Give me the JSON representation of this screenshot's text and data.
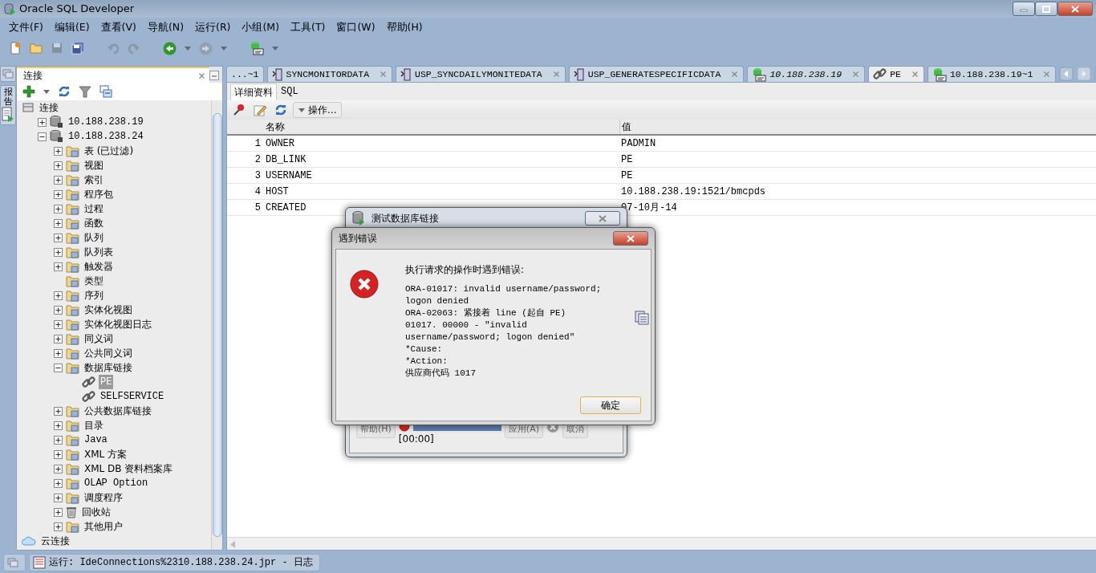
{
  "window": {
    "title": "Oracle SQL Developer"
  },
  "menu": [
    "文件(F)",
    "编辑(E)",
    "查看(V)",
    "导航(N)",
    "运行(R)",
    "小组(M)",
    "工具(T)",
    "窗口(W)",
    "帮助(H)"
  ],
  "toolbar": [
    {
      "kind": "new",
      "disabled": false
    },
    {
      "kind": "open",
      "disabled": false
    },
    {
      "kind": "save",
      "disabled": true
    },
    {
      "kind": "saveall",
      "disabled": false
    },
    {
      "kind": "undo",
      "disabled": true
    },
    {
      "kind": "redo",
      "disabled": true
    },
    {
      "kind": "back",
      "disabled": false
    },
    {
      "kind": "forward",
      "disabled": true
    },
    {
      "kind": "sql",
      "disabled": false
    }
  ],
  "side_tab": {
    "label": "报告"
  },
  "connections_panel": {
    "title": "连接",
    "tree": [
      {
        "label": "连接",
        "kind": "root",
        "selected": false,
        "children": [
          {
            "label": "10.188.238.19",
            "kind": "db",
            "expanded": false,
            "selected": false
          },
          {
            "label": "10.188.238.24",
            "kind": "db",
            "expanded": true,
            "selected": false,
            "children": [
              {
                "label": "表 (已过滤)",
                "kind": "folder",
                "expanded": false,
                "selected": false
              },
              {
                "label": "视图",
                "kind": "folder",
                "expanded": false,
                "selected": false
              },
              {
                "label": "索引",
                "kind": "folder",
                "expanded": false,
                "selected": false
              },
              {
                "label": "程序包",
                "kind": "folder",
                "expanded": false,
                "selected": false
              },
              {
                "label": "过程",
                "kind": "folder",
                "expanded": false,
                "selected": false
              },
              {
                "label": "函数",
                "kind": "folder",
                "expanded": false,
                "selected": false
              },
              {
                "label": "队列",
                "kind": "folder",
                "expanded": false,
                "selected": false
              },
              {
                "label": "队列表",
                "kind": "folder",
                "expanded": false,
                "selected": false
              },
              {
                "label": "触发器",
                "kind": "folder",
                "expanded": false,
                "selected": false
              },
              {
                "label": "类型",
                "kind": "folder",
                "selected": false
              },
              {
                "label": "序列",
                "kind": "folder",
                "expanded": false,
                "selected": false
              },
              {
                "label": "实体化视图",
                "kind": "folder",
                "expanded": false,
                "selected": false
              },
              {
                "label": "实体化视图日志",
                "kind": "folder",
                "expanded": false,
                "selected": false
              },
              {
                "label": "同义词",
                "kind": "folder",
                "expanded": false,
                "selected": false
              },
              {
                "label": "公共同义词",
                "kind": "folder",
                "expanded": false,
                "selected": false
              },
              {
                "label": "数据库链接",
                "kind": "folder",
                "expanded": true,
                "selected": false,
                "children": [
                  {
                    "label": "PE",
                    "kind": "link",
                    "selected": true
                  },
                  {
                    "label": "SELFSERVICE",
                    "kind": "link",
                    "selected": false
                  }
                ]
              },
              {
                "label": "公共数据库链接",
                "kind": "folder",
                "expanded": false,
                "selected": false
              },
              {
                "label": "目录",
                "kind": "folder",
                "expanded": false,
                "selected": false
              },
              {
                "label": "Java",
                "kind": "folder",
                "expanded": false,
                "selected": false
              },
              {
                "label": "XML 方案",
                "kind": "folder",
                "expanded": false,
                "selected": false
              },
              {
                "label": "XML DB 资料档案库",
                "kind": "folder",
                "expanded": false,
                "selected": false
              },
              {
                "label": "OLAP Option",
                "kind": "folder",
                "expanded": false,
                "selected": false
              },
              {
                "label": "调度程序",
                "kind": "folder",
                "expanded": false,
                "selected": false
              },
              {
                "label": "回收站",
                "kind": "trash",
                "expanded": false,
                "selected": false
              },
              {
                "label": "其他用户",
                "kind": "folder",
                "expanded": false,
                "selected": false
              }
            ]
          }
        ]
      },
      {
        "label": "云连接",
        "kind": "cloud",
        "selected": false
      }
    ]
  },
  "editor": {
    "tabs": [
      {
        "label": "...~1",
        "kind": "none",
        "selected": false,
        "italic": false,
        "closable": false
      },
      {
        "label": "SYNCMONITORDATA",
        "kind": "procedure",
        "selected": false,
        "italic": false,
        "closable": true
      },
      {
        "label": "USP_SYNCDAILYMONITEDATA",
        "kind": "procedure",
        "selected": false,
        "italic": false,
        "closable": true
      },
      {
        "label": "USP_GENERATESPECIFICDATA",
        "kind": "procedure",
        "selected": false,
        "italic": false,
        "closable": true
      },
      {
        "label": "10.188.238.19",
        "kind": "sql",
        "selected": false,
        "italic": true,
        "closable": true
      },
      {
        "label": "PE",
        "kind": "link",
        "selected": true,
        "italic": false,
        "closable": true
      },
      {
        "label": "10.188.238.19~1",
        "kind": "sql",
        "selected": false,
        "italic": false,
        "closable": true
      }
    ],
    "subtabs": [
      {
        "label": "详细资料",
        "selected": true
      },
      {
        "label": "SQL",
        "selected": false
      }
    ],
    "actions_button": "操作...",
    "table": {
      "columns": [
        "名称",
        "值"
      ],
      "rows": [
        {
          "index": "1",
          "name": "OWNER",
          "value": "PADMIN"
        },
        {
          "index": "2",
          "name": "DB_LINK",
          "value": "PE"
        },
        {
          "index": "3",
          "name": "USERNAME",
          "value": "PE"
        },
        {
          "index": "4",
          "name": "HOST",
          "value": "10.188.238.19:1521/bmcpds"
        },
        {
          "index": "5",
          "name": "CREATED",
          "value": "07-10月-14"
        }
      ]
    }
  },
  "test_dialog": {
    "title": "测试数据库链接",
    "buttons": [
      "帮助(H)",
      "应用(A)",
      "取消"
    ],
    "timer": "[00:00]",
    "progress": {
      "level": 1
    }
  },
  "error_dialog": {
    "title": "遇到错误",
    "heading": "执行请求的操作时遇到错误:",
    "message": [
      "ORA-01017: invalid username/password; logon denied",
      "ORA-02063: 紧接着 line (起自 PE)",
      "01017. 00000 -  \"invalid username/password; logon denied\"",
      "*Cause:",
      "*Action:",
      "供应商代码 1017"
    ],
    "ok": "确定"
  },
  "status_bar": {
    "text": "运行: IdeConnections%2310.188.238.24.jpr - 日志"
  }
}
